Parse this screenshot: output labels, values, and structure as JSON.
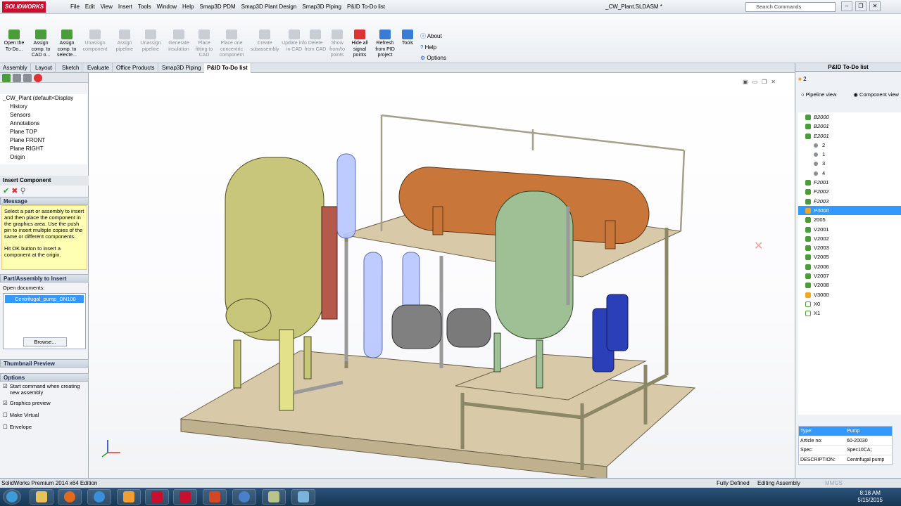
{
  "app": {
    "logo_text": "SOLIDWORKS",
    "document_title": "_CW_Plant.SLDASM *"
  },
  "menu": [
    "File",
    "Edit",
    "View",
    "Insert",
    "Tools",
    "Window",
    "Help",
    "Smap3D PDM",
    "Smap3D Plant Design",
    "Smap3D Piping",
    "P&ID To-Do list"
  ],
  "search": {
    "placeholder": "Search Commands"
  },
  "ribbon": {
    "buttons": [
      {
        "label": "Open the To-Do...",
        "enabled": true
      },
      {
        "label": "Assign comp. to CAD o...",
        "enabled": true
      },
      {
        "label": "Assign comp. to selecte...",
        "enabled": true
      },
      {
        "label": "Unassign component",
        "enabled": false
      },
      {
        "label": "Assign pipeline",
        "enabled": false
      },
      {
        "label": "Unassign pipeline",
        "enabled": false
      },
      {
        "label": "Generate insulation",
        "enabled": false
      },
      {
        "label": "Place fitting to CAD",
        "enabled": false
      },
      {
        "label": "Place one concentric component",
        "enabled": false
      },
      {
        "label": "Create subassembly",
        "enabled": false
      },
      {
        "label": "Update info in CAD",
        "enabled": false
      },
      {
        "label": "Delete from CAD",
        "enabled": false
      },
      {
        "label": "Show from/to points",
        "enabled": false
      },
      {
        "label": "Hide all signal points",
        "enabled": true
      },
      {
        "label": "Refresh from PID project",
        "enabled": true
      },
      {
        "label": "Tools",
        "enabled": true
      }
    ],
    "about": "About",
    "help": "Help",
    "options": "Options"
  },
  "tabs": [
    "Assembly",
    "Layout",
    "Sketch",
    "Evaluate",
    "Office Products",
    "Smap3D Piping",
    "P&ID To-Do list"
  ],
  "active_tab": "P&ID To-Do list",
  "tree": {
    "root": "_CW_Plant (default<Display",
    "items": [
      "History",
      "Sensors",
      "Annotations",
      "Plane TOP",
      "Plane FRONT",
      "Plane RIGHT",
      "Origin"
    ]
  },
  "insert_component": {
    "title": "Insert Component",
    "message_header": "Message",
    "message": "Select a part or assembly to insert and then place the component in the graphics area. Use the push pin to insert multiple copies of the same or different components.",
    "message2": "Hit OK button to insert a component at the origin.",
    "part_header": "Part/Assembly to Insert",
    "open_documents_label": "Open documents:",
    "open_document": "Centrifugal_pump_DN100",
    "browse": "Browse...",
    "thumbnail_header": "Thumbnail Preview",
    "options_header": "Options",
    "options": [
      {
        "label": "Start command when creating new assembly",
        "checked": true
      },
      {
        "label": "Graphics preview",
        "checked": true
      },
      {
        "label": "Make Virtual",
        "checked": false
      },
      {
        "label": "Envelope",
        "checked": false
      }
    ]
  },
  "right_panel": {
    "title": "P&ID To-Do list",
    "count": "2",
    "view_pipeline": "Pipeline view",
    "view_component": "Component view",
    "items": [
      {
        "label": "B2000",
        "icon": "green",
        "italic": true,
        "selected": false,
        "indent": 0
      },
      {
        "label": "B2001",
        "icon": "green",
        "italic": true,
        "selected": false,
        "indent": 0
      },
      {
        "label": "E2001",
        "icon": "green",
        "italic": true,
        "selected": false,
        "indent": 0
      },
      {
        "label": "2",
        "icon": "gray",
        "italic": false,
        "selected": false,
        "indent": 1
      },
      {
        "label": "1",
        "icon": "gray",
        "italic": false,
        "selected": false,
        "indent": 1
      },
      {
        "label": "3",
        "icon": "gray",
        "italic": false,
        "selected": false,
        "indent": 1
      },
      {
        "label": "4",
        "icon": "gray",
        "italic": false,
        "selected": false,
        "indent": 1
      },
      {
        "label": "F2001",
        "icon": "green",
        "italic": true,
        "selected": false,
        "indent": 0
      },
      {
        "label": "F2002",
        "icon": "green",
        "italic": true,
        "selected": false,
        "indent": 0
      },
      {
        "label": "F2003",
        "icon": "green",
        "italic": true,
        "selected": false,
        "indent": 0
      },
      {
        "label": "P3000",
        "icon": "orange",
        "italic": true,
        "selected": true,
        "indent": 0
      },
      {
        "label": "2005",
        "icon": "green",
        "italic": false,
        "selected": false,
        "indent": 0
      },
      {
        "label": "V2001",
        "icon": "green",
        "italic": false,
        "selected": false,
        "indent": 0
      },
      {
        "label": "V2002",
        "icon": "green",
        "italic": false,
        "selected": false,
        "indent": 0
      },
      {
        "label": "V2003",
        "icon": "green",
        "italic": false,
        "selected": false,
        "indent": 0
      },
      {
        "label": "V2005",
        "icon": "green",
        "italic": false,
        "selected": false,
        "indent": 0
      },
      {
        "label": "V2006",
        "icon": "green",
        "italic": false,
        "selected": false,
        "indent": 0
      },
      {
        "label": "V2007",
        "icon": "green",
        "italic": false,
        "selected": false,
        "indent": 0
      },
      {
        "label": "V2008",
        "icon": "green",
        "italic": false,
        "selected": false,
        "indent": 0
      },
      {
        "label": "V3000",
        "icon": "orange",
        "italic": false,
        "selected": false,
        "indent": 0
      },
      {
        "label": "X0",
        "icon": "wire",
        "italic": false,
        "selected": false,
        "indent": 0
      },
      {
        "label": "X1",
        "icon": "wire",
        "italic": false,
        "selected": false,
        "indent": 0
      }
    ],
    "properties": [
      {
        "key": "Type:",
        "value": "Pump",
        "highlight": true
      },
      {
        "key": "Article no:",
        "value": "60-20030",
        "highlight": false
      },
      {
        "key": "Spec:",
        "value": "Spec10CA;",
        "highlight": false
      },
      {
        "key": "DESCRIPTION:",
        "value": "Centrifugal pump",
        "highlight": false
      }
    ]
  },
  "status": {
    "edition": "SolidWorks Premium 2014 x64 Edition",
    "mmgs": "MMGS",
    "state": "Fully Defined",
    "mode": "Editing Assembly"
  },
  "clock": {
    "time": "8:18 AM",
    "date": "5/15/2015"
  },
  "colors": {
    "accent": "#3399ff",
    "brand": "#c8102e",
    "vessel_olive": "#c8c67a",
    "vessel_green": "#9fbf95",
    "tank_copper": "#c8763a",
    "pump_blue": "#2b3fb8",
    "frame": "#ddd9b6",
    "base": "#d8c9a8"
  }
}
